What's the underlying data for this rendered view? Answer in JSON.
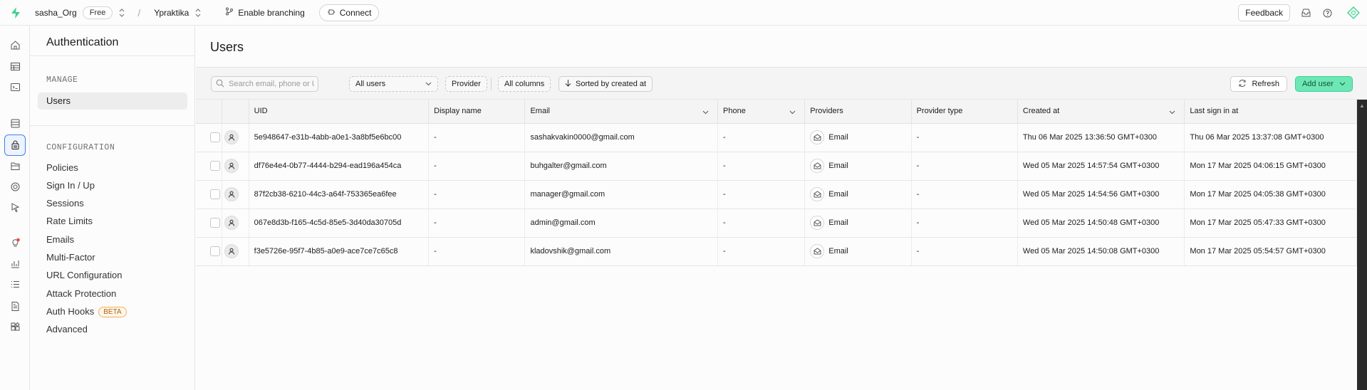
{
  "topbar": {
    "org_name": "sasha_Org",
    "plan_badge": "Free",
    "project_name": "Ypraktika",
    "branching_label": "Enable branching",
    "connect_label": "Connect",
    "feedback_label": "Feedback"
  },
  "sidepanel": {
    "title": "Authentication",
    "manage_section": "MANAGE",
    "manage_items": [
      "Users"
    ],
    "config_section": "CONFIGURATION",
    "config_items": [
      "Policies",
      "Sign In / Up",
      "Sessions",
      "Rate Limits",
      "Emails",
      "Multi-Factor",
      "URL Configuration",
      "Attack Protection",
      "Auth Hooks",
      "Advanced"
    ],
    "beta_badge": "BETA"
  },
  "main": {
    "page_title": "Users",
    "search_placeholder": "Search email, phone or UID",
    "filter_users": "All users",
    "filter_provider": "Provider",
    "columns_button": "All columns",
    "sort_button": "Sorted by created at",
    "refresh_label": "Refresh",
    "add_user_label": "Add user"
  },
  "table": {
    "headers": [
      "UID",
      "Display name",
      "Email",
      "Phone",
      "Providers",
      "Provider type",
      "Created at",
      "Last sign in at"
    ],
    "rows": [
      {
        "uid": "5e948647-e31b-4abb-a0e1-3a8bf5e6bc00",
        "display_name": "-",
        "email": "sashakvakin0000@gmail.com",
        "phone": "-",
        "provider": "Email",
        "provider_type": "-",
        "created_at": "Thu 06 Mar 2025 13:36:50 GMT+0300",
        "last_sign_in": "Thu 06 Mar 2025 13:37:08 GMT+0300"
      },
      {
        "uid": "df76e4e4-0b77-4444-b294-ead196a454ca",
        "display_name": "-",
        "email": "buhgalter@gmail.com",
        "phone": "-",
        "provider": "Email",
        "provider_type": "-",
        "created_at": "Wed 05 Mar 2025 14:57:54 GMT+0300",
        "last_sign_in": "Mon 17 Mar 2025 04:06:15 GMT+0300"
      },
      {
        "uid": "87f2cb38-6210-44c3-a64f-753365ea6fee",
        "display_name": "-",
        "email": "manager@gmail.com",
        "phone": "-",
        "provider": "Email",
        "provider_type": "-",
        "created_at": "Wed 05 Mar 2025 14:54:56 GMT+0300",
        "last_sign_in": "Mon 17 Mar 2025 04:05:38 GMT+0300"
      },
      {
        "uid": "067e8d3b-f165-4c5d-85e5-3d40da30705d",
        "display_name": "-",
        "email": "admin@gmail.com",
        "phone": "-",
        "provider": "Email",
        "provider_type": "-",
        "created_at": "Wed 05 Mar 2025 14:50:48 GMT+0300",
        "last_sign_in": "Mon 17 Mar 2025 05:47:33 GMT+0300"
      },
      {
        "uid": "f3e5726e-95f7-4b85-a0e9-ace7ce7c65c8",
        "display_name": "-",
        "email": "kladovshik@gmail.com",
        "phone": "-",
        "provider": "Email",
        "provider_type": "-",
        "created_at": "Wed 05 Mar 2025 14:50:08 GMT+0300",
        "last_sign_in": "Mon 17 Mar 2025 05:54:57 GMT+0300"
      }
    ]
  },
  "colors": {
    "brand_green": "#3ecf8e",
    "add_button_bg": "#6ee7b7",
    "active_rail_border": "#3b82f6"
  },
  "rail_icons": [
    "home-icon",
    "table-editor-icon",
    "sql-editor-icon",
    "database-icon",
    "authentication-icon",
    "storage-icon",
    "realtime-icon",
    "edge-functions-icon",
    "advisors-icon",
    "reports-icon",
    "logs-icon",
    "api-docs-icon",
    "integrations-icon"
  ]
}
